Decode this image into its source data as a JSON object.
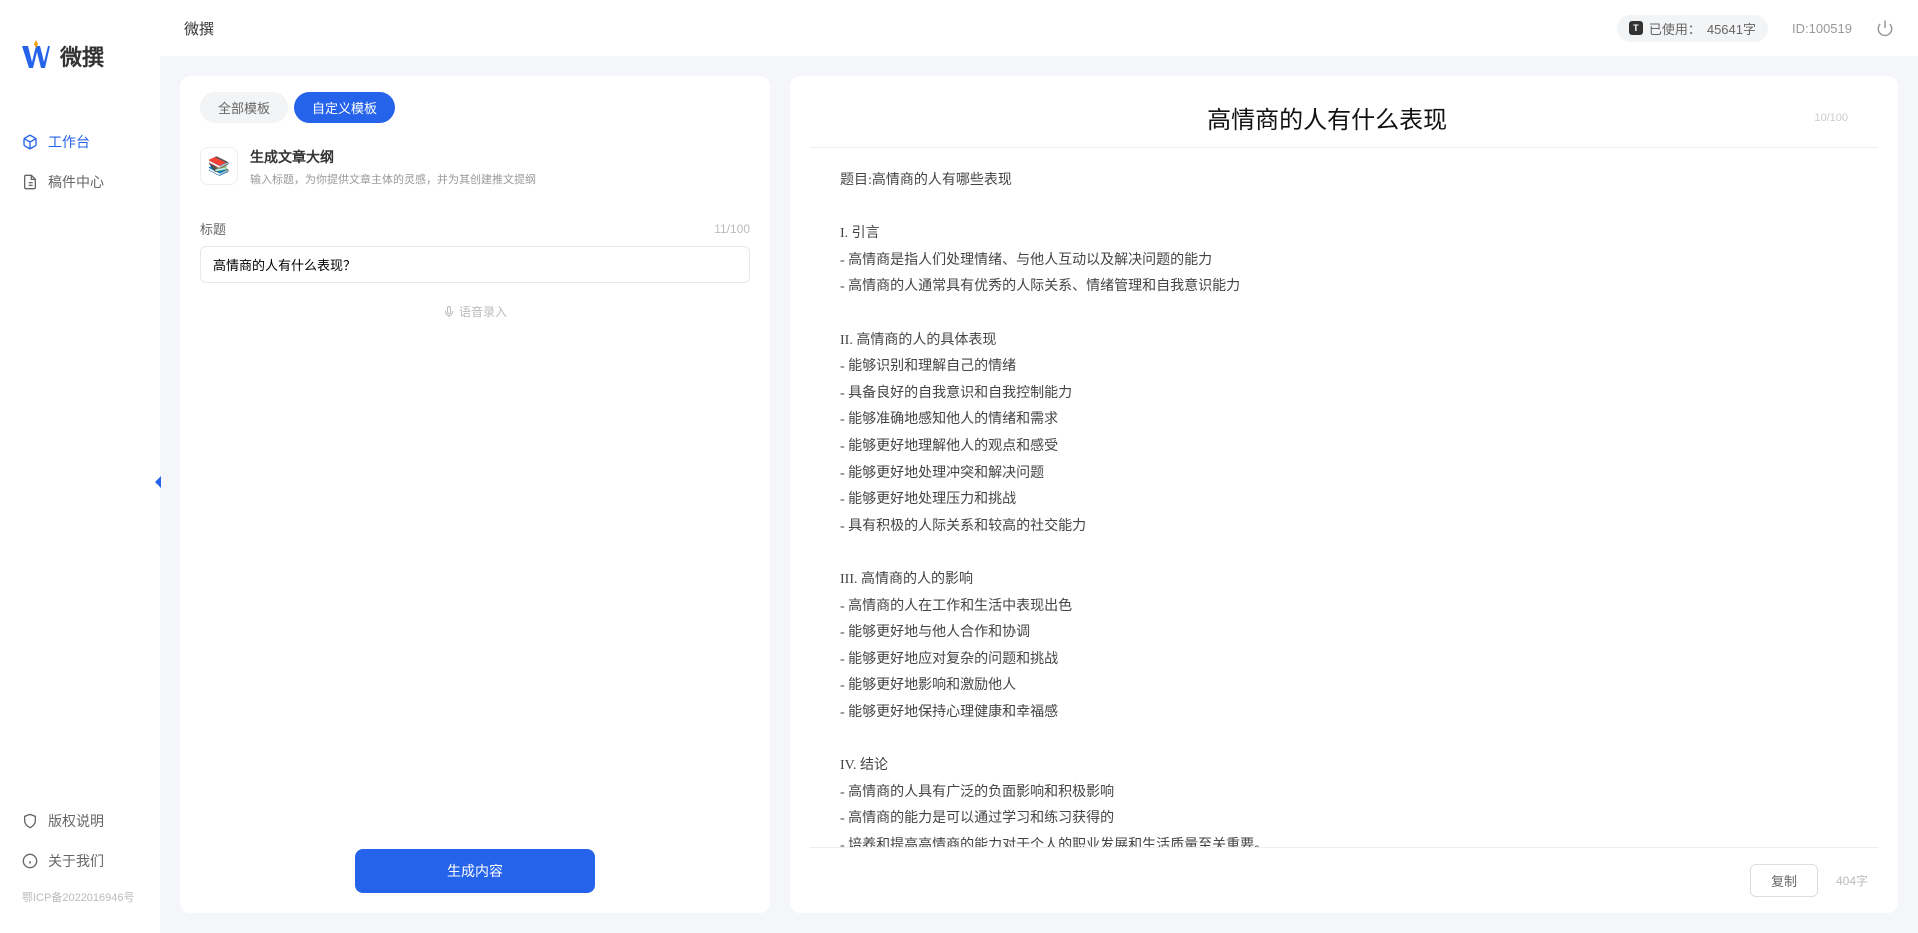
{
  "app_name": "微撰",
  "header": {
    "title": "微撰",
    "usage_label": "已使用：",
    "usage_value": "45641字",
    "user_id_label": "ID:100519"
  },
  "sidebar": {
    "nav": [
      {
        "label": "工作台",
        "active": true
      },
      {
        "label": "稿件中心",
        "active": false
      }
    ],
    "bottom": [
      {
        "label": "版权说明"
      },
      {
        "label": "关于我们"
      }
    ],
    "icp": "鄂ICP备2022016946号"
  },
  "tabs": [
    {
      "label": "全部模板",
      "active": false
    },
    {
      "label": "自定义模板",
      "active": true
    }
  ],
  "template": {
    "name": "生成文章大纲",
    "desc": "输入标题，为你提供文章主体的灵感，并为其创建推文提纲"
  },
  "form": {
    "title_label": "标题",
    "title_count": "11/100",
    "title_value": "高情商的人有什么表现？",
    "voice_label": "语音录入"
  },
  "generate_label": "生成内容",
  "output": {
    "title": "高情商的人有什么表现",
    "title_count": "10/100",
    "body": "题目:高情商的人有哪些表现\n\nI. 引言\n- 高情商是指人们处理情绪、与他人互动以及解决问题的能力\n- 高情商的人通常具有优秀的人际关系、情绪管理和自我意识能力\n\nII. 高情商的人的具体表现\n- 能够识别和理解自己的情绪\n- 具备良好的自我意识和自我控制能力\n- 能够准确地感知他人的情绪和需求\n- 能够更好地理解他人的观点和感受\n- 能够更好地处理冲突和解决问题\n- 能够更好地处理压力和挑战\n- 具有积极的人际关系和较高的社交能力\n\nIII. 高情商的人的影响\n- 高情商的人在工作和生活中表现出色\n- 能够更好地与他人合作和协调\n- 能够更好地应对复杂的问题和挑战\n- 能够更好地影响和激励他人\n- 能够更好地保持心理健康和幸福感\n\nIV. 结论\n- 高情商的人具有广泛的负面影响和积极影响\n- 高情商的能力是可以通过学习和练习获得的\n- 培养和提高高情商的能力对于个人的职业发展和生活质量至关重要。",
    "copy_label": "复制",
    "word_count": "404字"
  }
}
